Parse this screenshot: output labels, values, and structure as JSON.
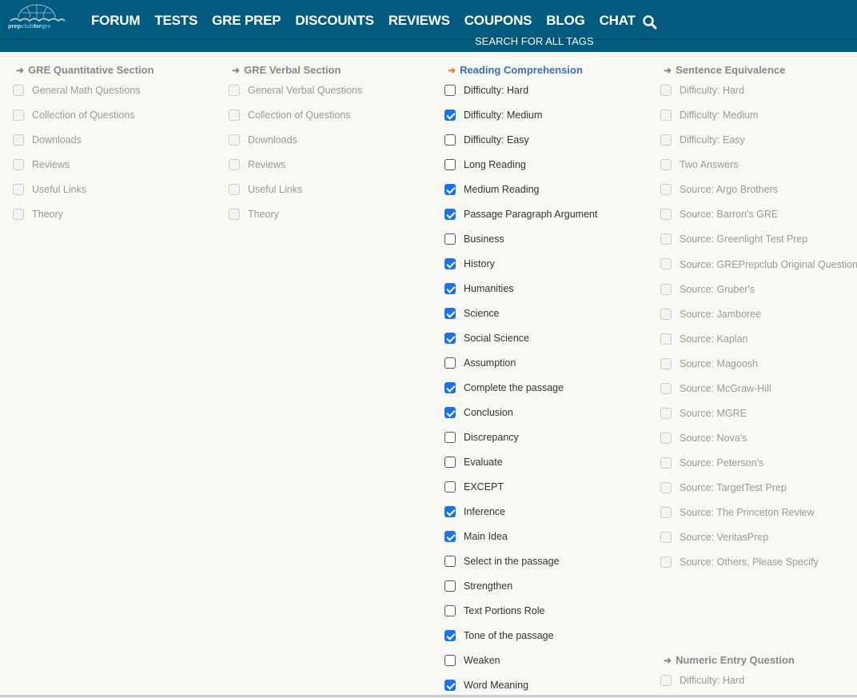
{
  "header": {
    "logo_text": "prepclubforgre",
    "nav": [
      "FORUM",
      "TESTS",
      "GRE PREP",
      "DISCOUNTS",
      "REVIEWS",
      "COUPONS",
      "BLOG",
      "CHAT"
    ],
    "search_icon": "search-icon",
    "subtitle": "SEARCH FOR ALL TAGS"
  },
  "colors": {
    "header": "#015b7e",
    "accent_arrow": "#f07d1a",
    "active_heading": "#3a6ec0",
    "checkbox": "#1a73e8"
  },
  "columns": [
    {
      "title": "GRE Quantitative Section",
      "active": false,
      "items": [
        {
          "label": "General Math Questions",
          "checked": false
        },
        {
          "label": "Collection of Questions",
          "checked": false
        },
        {
          "label": "Downloads",
          "checked": false
        },
        {
          "label": "Reviews",
          "checked": false
        },
        {
          "label": "Useful Links",
          "checked": false
        },
        {
          "label": "Theory",
          "checked": false
        }
      ]
    },
    {
      "title": "GRE Verbal Section",
      "active": false,
      "items": [
        {
          "label": "General Verbal Questions",
          "checked": false
        },
        {
          "label": "Collection of Questions",
          "checked": false
        },
        {
          "label": "Downloads",
          "checked": false
        },
        {
          "label": "Reviews",
          "checked": false
        },
        {
          "label": "Useful Links",
          "checked": false
        },
        {
          "label": "Theory",
          "checked": false
        }
      ]
    },
    {
      "title": "Reading Comprehension",
      "active": true,
      "items": [
        {
          "label": "Difficulty: Hard",
          "checked": false
        },
        {
          "label": "Difficulty: Medium",
          "checked": true
        },
        {
          "label": "Difficulty: Easy",
          "checked": false
        },
        {
          "label": "Long Reading",
          "checked": false
        },
        {
          "label": "Medium Reading",
          "checked": true
        },
        {
          "label": "Passage Paragraph Argument",
          "checked": true
        },
        {
          "label": "Business",
          "checked": false
        },
        {
          "label": "History",
          "checked": true
        },
        {
          "label": "Humanities",
          "checked": true
        },
        {
          "label": "Science",
          "checked": true
        },
        {
          "label": "Social Science",
          "checked": true
        },
        {
          "label": "Assumption",
          "checked": false
        },
        {
          "label": "Complete the passage",
          "checked": true
        },
        {
          "label": "Conclusion",
          "checked": true
        },
        {
          "label": "Discrepancy",
          "checked": false
        },
        {
          "label": "Evaluate",
          "checked": false
        },
        {
          "label": "EXCEPT",
          "checked": false
        },
        {
          "label": "Inference",
          "checked": true
        },
        {
          "label": "Main Idea",
          "checked": true
        },
        {
          "label": "Select in the passage",
          "checked": false
        },
        {
          "label": "Strengthen",
          "checked": false
        },
        {
          "label": "Text Portions Role",
          "checked": false
        },
        {
          "label": "Tone of the passage",
          "checked": true
        },
        {
          "label": "Weaken",
          "checked": false
        },
        {
          "label": "Word Meaning",
          "checked": true
        }
      ]
    },
    {
      "title": "Sentence Equivalence",
      "active": false,
      "items": [
        {
          "label": "Difficulty: Hard",
          "checked": false
        },
        {
          "label": "Difficulty: Medium",
          "checked": false
        },
        {
          "label": "Difficulty: Easy",
          "checked": false
        },
        {
          "label": "Two Answers",
          "checked": false
        },
        {
          "label": "Source: Argo Brothers",
          "checked": false
        },
        {
          "label": "Source: Barron's GRE",
          "checked": false
        },
        {
          "label": "Source: Greenlight Test Prep",
          "checked": false
        },
        {
          "label": "Source: GREPrepclub Original Question",
          "checked": false
        },
        {
          "label": "Source: Gruber's",
          "checked": false
        },
        {
          "label": "Source: Jamboree",
          "checked": false
        },
        {
          "label": "Source: Kaplan",
          "checked": false
        },
        {
          "label": "Source: Magoosh",
          "checked": false
        },
        {
          "label": "Source: McGraw-Hill",
          "checked": false
        },
        {
          "label": "Source: MGRE",
          "checked": false
        },
        {
          "label": "Source: Nova's",
          "checked": false
        },
        {
          "label": "Source: Peterson's",
          "checked": false
        },
        {
          "label": "Source: TargetTest Prep",
          "checked": false
        },
        {
          "label": "Source: The Princeton Review",
          "checked": false
        },
        {
          "label": "Source: VeritasPrep",
          "checked": false
        },
        {
          "label": "Source: Others, Please Specify",
          "checked": false
        }
      ]
    },
    {
      "title": "Numeric Entry Question",
      "active": false,
      "items": [
        {
          "label": "Difficulty: Hard",
          "checked": false
        }
      ]
    }
  ]
}
